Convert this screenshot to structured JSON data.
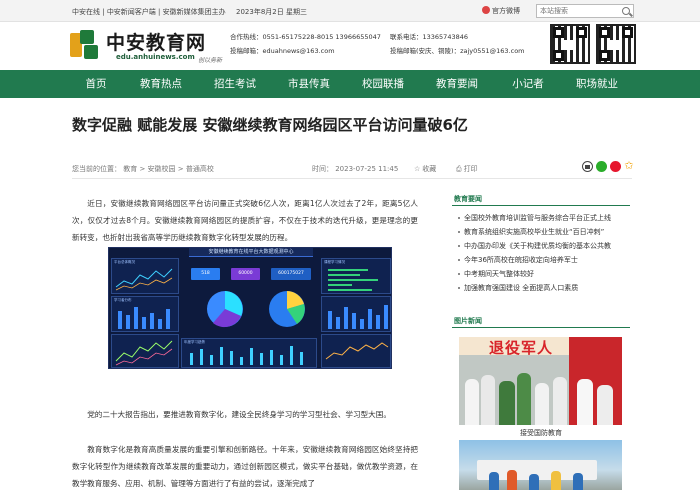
{
  "topbar": {
    "links": [
      "中安在线",
      "中安新闻客户端",
      "安徽新媒体集团主办"
    ],
    "date": "2023年8月2日 星期三",
    "weibo": "官方微博",
    "search_placeholder": "本站搜索"
  },
  "header": {
    "logo_text": "中安教育网",
    "logo_url": "edu.anhuinews.com",
    "logo_slogan": "创以务新",
    "contact_left": [
      "合作热线：0551-65175228-8015 13966655047",
      "投稿邮箱：eduahnews@163.com"
    ],
    "contact_right": [
      "联系电话：13365743846",
      "投稿邮箱(安庆、铜陵)：zajy0551@163.com"
    ]
  },
  "nav": {
    "items": [
      "首页",
      "教育热点",
      "招生考试",
      "市县传真",
      "校园联播",
      "教育要闻",
      "小记者",
      "职场就业"
    ]
  },
  "article": {
    "title": "数字促融 赋能发展 安徽继续教育网络园区平台访问量破6亿",
    "breadcrumb": "您当前的位置： 教育 > 安徽校园 > 普通高校",
    "time": "时间： 2023-07-25 11:45",
    "favorite": "收藏",
    "print": "打印",
    "paragraphs": [
      "近日，安徽继续教育网络园区平台访问量正式突破6亿人次，距离1亿人次过去了2年，距离5亿人次，仅仅才过去8个月。安徽继续教育网络园区的提质扩容，不仅在于技术的迭代升级，更是理念的更新转变，也折射出我省高等学历继续教育数字化转型发展的历程。",
      "党的二十大报告指出，要推进教育数字化，建设全民终身学习的学习型社会、学习型大国。",
      "教育数字化是教育高质量发展的重要引擎和创新路径。十年来，安徽继续教育网络园区始终坚持把数字化转型作为继续教育改革发展的重要动力，通过创新园区模式，做实平台基础，做优教学资源，在教学教育服务、应用、机制、管理等方面进行了有益的尝试，逐渐完成了"
    ]
  },
  "dashboard": {
    "title": "安徽继续教育在线平台大数据观测中心",
    "stats": [
      "518",
      "60000",
      "600175027"
    ],
    "labels": [
      "平台总体概况",
      "学习者分布",
      "课程学习情况",
      "年度学习趋势"
    ]
  },
  "share": {
    "icons": [
      "share-icon",
      "wechat-icon",
      "weibo-icon",
      "star-icon"
    ]
  },
  "sidebar": {
    "news_heading": "教育要闻",
    "news_items": [
      "全国校外教育培训监管与服务综合平台正式上线",
      "教育系统组织实施高校毕业生就业“百日冲刺”",
      "中办国办印发《关于构建优质均衡的基本公共教",
      "今年36所高校在皖招收定向培养军士",
      "中考期间天气整体较好",
      "加强教育强国建设 全面提高人口素质"
    ],
    "photo_heading": "图片新闻",
    "photo_banner": "退役军人",
    "photo_caption": "接受国防教育"
  },
  "colors": {
    "brand_green": "#217a4f",
    "dash_bg": "#0d1a3d"
  }
}
